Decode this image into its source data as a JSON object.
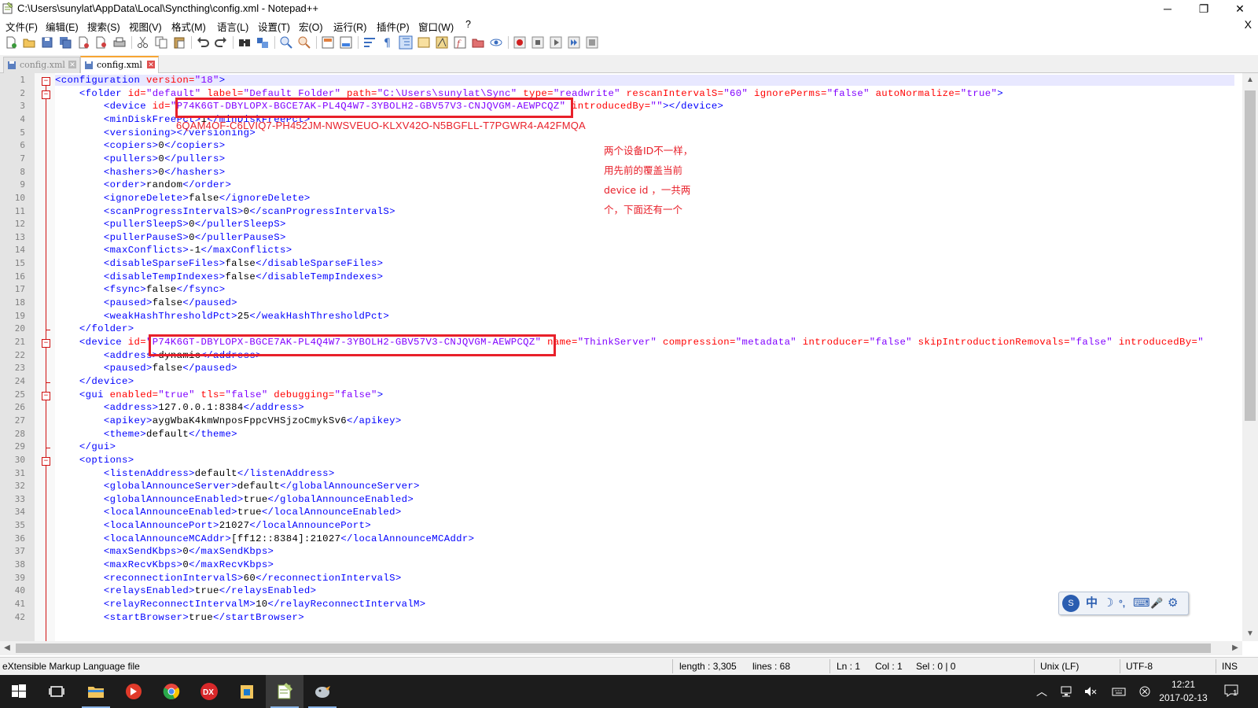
{
  "window": {
    "title": "C:\\Users\\sunylat\\AppData\\Local\\Syncthing\\config.xml - Notepad++",
    "minimize": "─",
    "maximize": "❐",
    "close": "✕"
  },
  "menu": {
    "items": [
      "文件(F)",
      "编辑(E)",
      "搜索(S)",
      "视图(V)",
      "格式(M)",
      "语言(L)",
      "设置(T)",
      "宏(O)",
      "运行(R)",
      "插件(P)",
      "窗口(W)",
      "?"
    ],
    "close": "X"
  },
  "tabs": [
    {
      "label": "config.xml",
      "active": false
    },
    {
      "label": "config.xml",
      "active": true
    }
  ],
  "editor": {
    "lines": [
      {
        "n": "1",
        "indent": 0,
        "parts": [
          [
            "tg",
            "<configuration "
          ],
          [
            "at",
            "version="
          ],
          [
            "av",
            "\"18\""
          ],
          [
            "tg",
            ">"
          ]
        ]
      },
      {
        "n": "2",
        "indent": 4,
        "parts": [
          [
            "tg",
            "<folder "
          ],
          [
            "at",
            "id="
          ],
          [
            "av",
            "\"default\""
          ],
          [
            "at",
            " label="
          ],
          [
            "av",
            "\"Default Folder\""
          ],
          [
            "at",
            " path="
          ],
          [
            "av",
            "\"C:\\Users\\sunylat\\Sync\""
          ],
          [
            "at",
            " type="
          ],
          [
            "av",
            "\"readwrite\""
          ],
          [
            "at",
            " rescanIntervalS="
          ],
          [
            "av",
            "\"60\""
          ],
          [
            "at",
            " ignorePerms="
          ],
          [
            "av",
            "\"false\""
          ],
          [
            "at",
            " autoNormalize="
          ],
          [
            "av",
            "\"true\""
          ],
          [
            "tg",
            ">"
          ]
        ]
      },
      {
        "n": "3",
        "indent": 8,
        "parts": [
          [
            "tg",
            "<device "
          ],
          [
            "at",
            "id="
          ],
          [
            "av",
            "\"P74K6GT-DBYLOPX-BGCE7AK-PL4Q4W7-3YBOLH2-GBV57V3-CNJQVGM-AEWPCQZ\""
          ],
          [
            "at",
            " introducedBy="
          ],
          [
            "av",
            "\"\""
          ],
          [
            "tg",
            "></device>"
          ]
        ]
      },
      {
        "n": "4",
        "indent": 8,
        "parts": [
          [
            "tg",
            "<minDiskFreePct>"
          ],
          [
            "tx",
            "1"
          ],
          [
            "tg",
            "</minDiskFreePct>"
          ]
        ]
      },
      {
        "n": "5",
        "indent": 8,
        "parts": [
          [
            "tg",
            "<versioning></versioning>"
          ]
        ]
      },
      {
        "n": "6",
        "indent": 8,
        "parts": [
          [
            "tg",
            "<copiers>"
          ],
          [
            "tx",
            "0"
          ],
          [
            "tg",
            "</copiers>"
          ]
        ]
      },
      {
        "n": "7",
        "indent": 8,
        "parts": [
          [
            "tg",
            "<pullers>"
          ],
          [
            "tx",
            "0"
          ],
          [
            "tg",
            "</pullers>"
          ]
        ]
      },
      {
        "n": "8",
        "indent": 8,
        "parts": [
          [
            "tg",
            "<hashers>"
          ],
          [
            "tx",
            "0"
          ],
          [
            "tg",
            "</hashers>"
          ]
        ]
      },
      {
        "n": "9",
        "indent": 8,
        "parts": [
          [
            "tg",
            "<order>"
          ],
          [
            "tx",
            "random"
          ],
          [
            "tg",
            "</order>"
          ]
        ]
      },
      {
        "n": "10",
        "indent": 8,
        "parts": [
          [
            "tg",
            "<ignoreDelete>"
          ],
          [
            "tx",
            "false"
          ],
          [
            "tg",
            "</ignoreDelete>"
          ]
        ]
      },
      {
        "n": "11",
        "indent": 8,
        "parts": [
          [
            "tg",
            "<scanProgressIntervalS>"
          ],
          [
            "tx",
            "0"
          ],
          [
            "tg",
            "</scanProgressIntervalS>"
          ]
        ]
      },
      {
        "n": "12",
        "indent": 8,
        "parts": [
          [
            "tg",
            "<pullerSleepS>"
          ],
          [
            "tx",
            "0"
          ],
          [
            "tg",
            "</pullerSleepS>"
          ]
        ]
      },
      {
        "n": "13",
        "indent": 8,
        "parts": [
          [
            "tg",
            "<pullerPauseS>"
          ],
          [
            "tx",
            "0"
          ],
          [
            "tg",
            "</pullerPauseS>"
          ]
        ]
      },
      {
        "n": "14",
        "indent": 8,
        "parts": [
          [
            "tg",
            "<maxConflicts>"
          ],
          [
            "tx",
            "-1"
          ],
          [
            "tg",
            "</maxConflicts>"
          ]
        ]
      },
      {
        "n": "15",
        "indent": 8,
        "parts": [
          [
            "tg",
            "<disableSparseFiles>"
          ],
          [
            "tx",
            "false"
          ],
          [
            "tg",
            "</disableSparseFiles>"
          ]
        ]
      },
      {
        "n": "16",
        "indent": 8,
        "parts": [
          [
            "tg",
            "<disableTempIndexes>"
          ],
          [
            "tx",
            "false"
          ],
          [
            "tg",
            "</disableTempIndexes>"
          ]
        ]
      },
      {
        "n": "17",
        "indent": 8,
        "parts": [
          [
            "tg",
            "<fsync>"
          ],
          [
            "tx",
            "false"
          ],
          [
            "tg",
            "</fsync>"
          ]
        ]
      },
      {
        "n": "18",
        "indent": 8,
        "parts": [
          [
            "tg",
            "<paused>"
          ],
          [
            "tx",
            "false"
          ],
          [
            "tg",
            "</paused>"
          ]
        ]
      },
      {
        "n": "19",
        "indent": 8,
        "parts": [
          [
            "tg",
            "<weakHashThresholdPct>"
          ],
          [
            "tx",
            "25"
          ],
          [
            "tg",
            "</weakHashThresholdPct>"
          ]
        ]
      },
      {
        "n": "20",
        "indent": 4,
        "parts": [
          [
            "tg",
            "</folder>"
          ]
        ]
      },
      {
        "n": "21",
        "indent": 4,
        "parts": [
          [
            "tg",
            "<device "
          ],
          [
            "at",
            "id="
          ],
          [
            "av",
            "\"P74K6GT-DBYLOPX-BGCE7AK-PL4Q4W7-3YBOLH2-GBV57V3-CNJQVGM-AEWPCQZ\""
          ],
          [
            "at",
            " name="
          ],
          [
            "av",
            "\"ThinkServer\""
          ],
          [
            "at",
            " compression="
          ],
          [
            "av",
            "\"metadata\""
          ],
          [
            "at",
            " introducer="
          ],
          [
            "av",
            "\"false\""
          ],
          [
            "at",
            " skipIntroductionRemovals="
          ],
          [
            "av",
            "\"false\""
          ],
          [
            "at",
            " introducedBy="
          ],
          [
            "av",
            "\""
          ]
        ]
      },
      {
        "n": "22",
        "indent": 8,
        "parts": [
          [
            "tg",
            "<address>"
          ],
          [
            "tx",
            "dynamic"
          ],
          [
            "tg",
            "</address>"
          ]
        ]
      },
      {
        "n": "23",
        "indent": 8,
        "parts": [
          [
            "tg",
            "<paused>"
          ],
          [
            "tx",
            "false"
          ],
          [
            "tg",
            "</paused>"
          ]
        ]
      },
      {
        "n": "24",
        "indent": 4,
        "parts": [
          [
            "tg",
            "</device>"
          ]
        ]
      },
      {
        "n": "25",
        "indent": 4,
        "parts": [
          [
            "tg",
            "<gui "
          ],
          [
            "at",
            "enabled="
          ],
          [
            "av",
            "\"true\""
          ],
          [
            "at",
            " tls="
          ],
          [
            "av",
            "\"false\""
          ],
          [
            "at",
            " debugging="
          ],
          [
            "av",
            "\"false\""
          ],
          [
            "tg",
            ">"
          ]
        ]
      },
      {
        "n": "26",
        "indent": 8,
        "parts": [
          [
            "tg",
            "<address>"
          ],
          [
            "tx",
            "127.0.0.1:8384"
          ],
          [
            "tg",
            "</address>"
          ]
        ]
      },
      {
        "n": "27",
        "indent": 8,
        "parts": [
          [
            "tg",
            "<apikey>"
          ],
          [
            "tx",
            "aygWbaK4kmWnposFppcVHSjzoCmykSv6"
          ],
          [
            "tg",
            "</apikey>"
          ]
        ]
      },
      {
        "n": "28",
        "indent": 8,
        "parts": [
          [
            "tg",
            "<theme>"
          ],
          [
            "tx",
            "default"
          ],
          [
            "tg",
            "</theme>"
          ]
        ]
      },
      {
        "n": "29",
        "indent": 4,
        "parts": [
          [
            "tg",
            "</gui>"
          ]
        ]
      },
      {
        "n": "30",
        "indent": 4,
        "parts": [
          [
            "tg",
            "<options>"
          ]
        ]
      },
      {
        "n": "31",
        "indent": 8,
        "parts": [
          [
            "tg",
            "<listenAddress>"
          ],
          [
            "tx",
            "default"
          ],
          [
            "tg",
            "</listenAddress>"
          ]
        ]
      },
      {
        "n": "32",
        "indent": 8,
        "parts": [
          [
            "tg",
            "<globalAnnounceServer>"
          ],
          [
            "tx",
            "default"
          ],
          [
            "tg",
            "</globalAnnounceServer>"
          ]
        ]
      },
      {
        "n": "33",
        "indent": 8,
        "parts": [
          [
            "tg",
            "<globalAnnounceEnabled>"
          ],
          [
            "tx",
            "true"
          ],
          [
            "tg",
            "</globalAnnounceEnabled>"
          ]
        ]
      },
      {
        "n": "34",
        "indent": 8,
        "parts": [
          [
            "tg",
            "<localAnnounceEnabled>"
          ],
          [
            "tx",
            "true"
          ],
          [
            "tg",
            "</localAnnounceEnabled>"
          ]
        ]
      },
      {
        "n": "35",
        "indent": 8,
        "parts": [
          [
            "tg",
            "<localAnnouncePort>"
          ],
          [
            "tx",
            "21027"
          ],
          [
            "tg",
            "</localAnnouncePort>"
          ]
        ]
      },
      {
        "n": "36",
        "indent": 8,
        "parts": [
          [
            "tg",
            "<localAnnounceMCAddr>"
          ],
          [
            "tx",
            "[ff12::8384]:21027"
          ],
          [
            "tg",
            "</localAnnounceMCAddr>"
          ]
        ]
      },
      {
        "n": "37",
        "indent": 8,
        "parts": [
          [
            "tg",
            "<maxSendKbps>"
          ],
          [
            "tx",
            "0"
          ],
          [
            "tg",
            "</maxSendKbps>"
          ]
        ]
      },
      {
        "n": "38",
        "indent": 8,
        "parts": [
          [
            "tg",
            "<maxRecvKbps>"
          ],
          [
            "tx",
            "0"
          ],
          [
            "tg",
            "</maxRecvKbps>"
          ]
        ]
      },
      {
        "n": "39",
        "indent": 8,
        "parts": [
          [
            "tg",
            "<reconnectionIntervalS>"
          ],
          [
            "tx",
            "60"
          ],
          [
            "tg",
            "</reconnectionIntervalS>"
          ]
        ]
      },
      {
        "n": "40",
        "indent": 8,
        "parts": [
          [
            "tg",
            "<relaysEnabled>"
          ],
          [
            "tx",
            "true"
          ],
          [
            "tg",
            "</relaysEnabled>"
          ]
        ]
      },
      {
        "n": "41",
        "indent": 8,
        "parts": [
          [
            "tg",
            "<relayReconnectIntervalM>"
          ],
          [
            "tx",
            "10"
          ],
          [
            "tg",
            "</relayReconnectIntervalM>"
          ]
        ]
      },
      {
        "n": "42",
        "indent": 8,
        "parts": [
          [
            "tg",
            "<startBrowser>"
          ],
          [
            "tx",
            "true"
          ],
          [
            "tg",
            "</startBrowser>"
          ]
        ]
      }
    ],
    "folds": {
      "open_markers": [
        "1",
        "2",
        "21",
        "25",
        "30"
      ],
      "close_markers": [
        "20",
        "24",
        "29"
      ]
    }
  },
  "annotation": {
    "new_device_id": "6QAM4OF-C6LVIQ7-PH452JM-NWSVEUO-KLXV42O-N5BGFLL-T7PGWR4-A42FMQA",
    "note_lines": [
      "两个设备ID不一样，",
      "用先前的覆盖当前",
      "device id ，一共两",
      "个，下面还有一个"
    ],
    "color": "#e8202a"
  },
  "ime": {
    "items": [
      "中",
      "☽",
      "°,",
      "⌨",
      "🎤",
      "⚙"
    ]
  },
  "statusbar": {
    "file_type": "eXtensible Markup Language file",
    "length": "length : 3,305",
    "lines": "lines : 68",
    "ln": "Ln : 1",
    "col": "Col : 1",
    "sel": "Sel : 0 | 0",
    "eol": "Unix (LF)",
    "encoding": "UTF-8",
    "mode": "INS"
  },
  "taskbar": {
    "time": "12:21",
    "date": "2017-02-13",
    "notifications": "1"
  }
}
